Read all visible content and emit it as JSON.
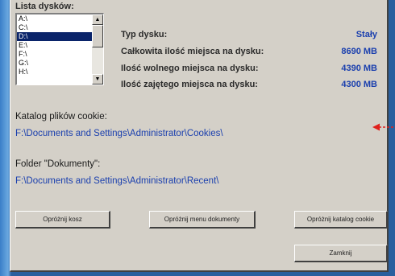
{
  "drives_label": "Lista dysków:",
  "drives": [
    "A:\\",
    "C:\\",
    "D:\\",
    "E:\\",
    "F:\\",
    "G:\\",
    "H:\\"
  ],
  "selected_drive_index": 2,
  "info": {
    "type_label": "Typ dysku:",
    "type_value": "Stały",
    "total_label": "Całkowita ilość miejsca na dysku:",
    "total_value": "8690 MB",
    "free_label": "Ilość wolnego miejsca na dysku:",
    "free_value": "4390 MB",
    "used_label": "Ilość zajętego miejsca na dysku:",
    "used_value": "4300 MB"
  },
  "cookies": {
    "label": "Katalog plików cookie:",
    "path": "F:\\Documents and Settings\\Administrator\\Cookies\\"
  },
  "documents": {
    "label": "Folder \"Dokumenty\":",
    "path": "F:\\Documents and Settings\\Administrator\\Recent\\"
  },
  "buttons": {
    "empty_trash": "Opróżnij kosz",
    "empty_documents": "Opróżnij menu dokumenty",
    "empty_cookies": "Opróżnij katalog cookie",
    "close": "Zamknij"
  },
  "colors": {
    "accent_red": "#e0201c",
    "value_blue": "#1a3fae"
  }
}
